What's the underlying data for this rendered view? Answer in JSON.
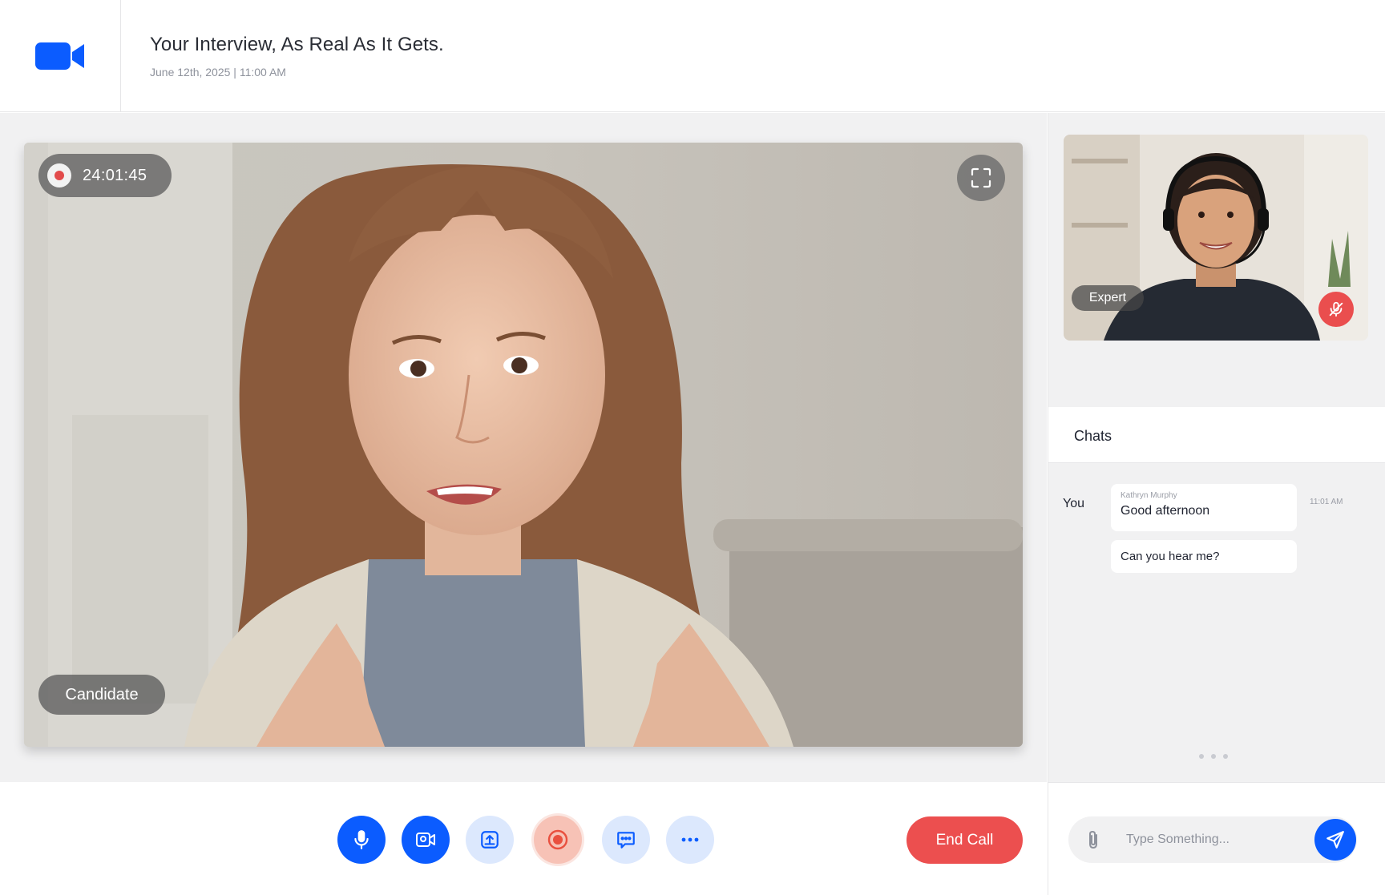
{
  "header": {
    "title": "Your Interview, As Real As It Gets.",
    "subtitle": "June 12th, 2025 | 11:00 AM",
    "logo_icon": "video-camera-icon",
    "brand_color": "#0b5cff"
  },
  "main_video": {
    "timer": "24:01:45",
    "participant_label": "Candidate",
    "recording_icon": "record-dot-icon",
    "expand_icon": "fullscreen-icon"
  },
  "expert_video": {
    "participant_label": "Expert",
    "muted_icon": "mic-off-icon"
  },
  "controls": {
    "buttons": [
      {
        "name": "microphone",
        "icon": "microphone-icon"
      },
      {
        "name": "camera",
        "icon": "video-camera-icon"
      },
      {
        "name": "share-screen",
        "icon": "upload-icon"
      },
      {
        "name": "record",
        "icon": "record-icon"
      },
      {
        "name": "chat",
        "icon": "chat-bubble-icon"
      },
      {
        "name": "more",
        "icon": "more-dots-icon"
      }
    ],
    "end_call_label": "End Call",
    "end_call_color": "#ec4f4f"
  },
  "chats": {
    "title": "Chats",
    "messages": [
      {
        "author_label": "You",
        "sender": "Kathryn Murphy",
        "text": "Good afternoon",
        "time": "11:01 AM"
      },
      {
        "text": "Can you hear me?"
      }
    ]
  },
  "composer": {
    "placeholder": "Type Something...",
    "value": "",
    "attach_icon": "paperclip-icon",
    "send_icon": "send-icon"
  }
}
